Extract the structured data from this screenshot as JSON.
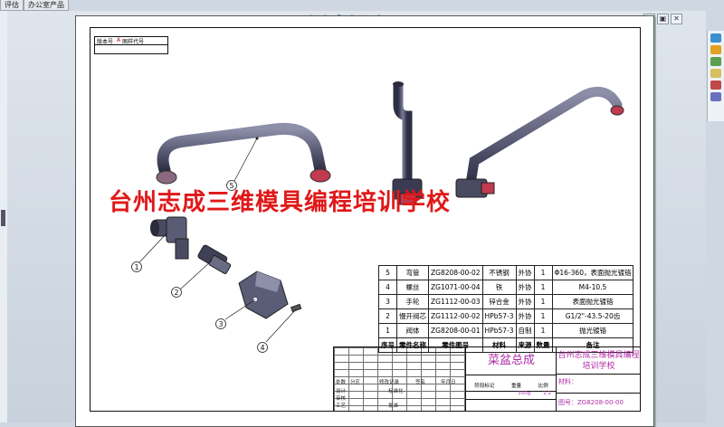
{
  "tabs": [
    "评估",
    "办公室产品"
  ],
  "view_toolbar_icons": [
    "zoom-fit-icon",
    "zoom-area-icon",
    "previous-view-icon",
    "zoom-icon",
    "display-style-icon",
    "appearance-icon",
    "section-view-icon"
  ],
  "window_controls": [
    "▫",
    "▣",
    "✕"
  ],
  "task_pane_icons": [
    "resources-icon",
    "library-icon",
    "explorer-icon",
    "view-palette-icon",
    "appearance-scenes-icon",
    "custom-properties-icon"
  ],
  "small_table": {
    "row1_label": "版本号",
    "row1_value": "A",
    "row1_extra": "图样代号",
    "row2_label": ""
  },
  "watermark": "台州志成三维模具编程培训学校",
  "balloons": [
    "1",
    "2",
    "3",
    "4",
    "5"
  ],
  "bom": {
    "rows": [
      [
        "5",
        "弯管",
        "ZG8208-00-02",
        "不锈钢",
        "外协",
        "1",
        "Φ16-360，表面抛光镀铬"
      ],
      [
        "4",
        "螺丝",
        "ZG1071-00-04",
        "铁",
        "外协",
        "1",
        "M4-10.5"
      ],
      [
        "3",
        "手轮",
        "ZG1112-00-03",
        "锌合金",
        "外协",
        "1",
        "表面抛光镀铬"
      ],
      [
        "2",
        "慢开阀芯",
        "ZG1112-00-02",
        "HPb57-3",
        "外协",
        "1",
        "G1/2\"-43.5-20齿"
      ],
      [
        "1",
        "阀体",
        "ZG8208-00-01",
        "HPb57-3",
        "自制",
        "1",
        "抛光镀铬"
      ]
    ],
    "header": [
      "序号",
      "零件名称",
      "零件图号",
      "材料",
      "来源",
      "数量",
      "备注"
    ]
  },
  "title_block": {
    "labels": [
      "处数",
      "分区",
      "修改记录",
      "签名",
      "年月日",
      "设计",
      "标准化",
      "审核",
      "工艺",
      "批准"
    ],
    "stage_label": "阶段标记",
    "weight_label": "重量",
    "scale_label": "比例",
    "weight_value": "350g",
    "scale_value": "1:2",
    "assembly_name": "菜盆总成",
    "school": "台州志成三维模具编程培训学校",
    "material_label": "材料：",
    "drawing_no": "图号：ZG8208-00-00"
  }
}
